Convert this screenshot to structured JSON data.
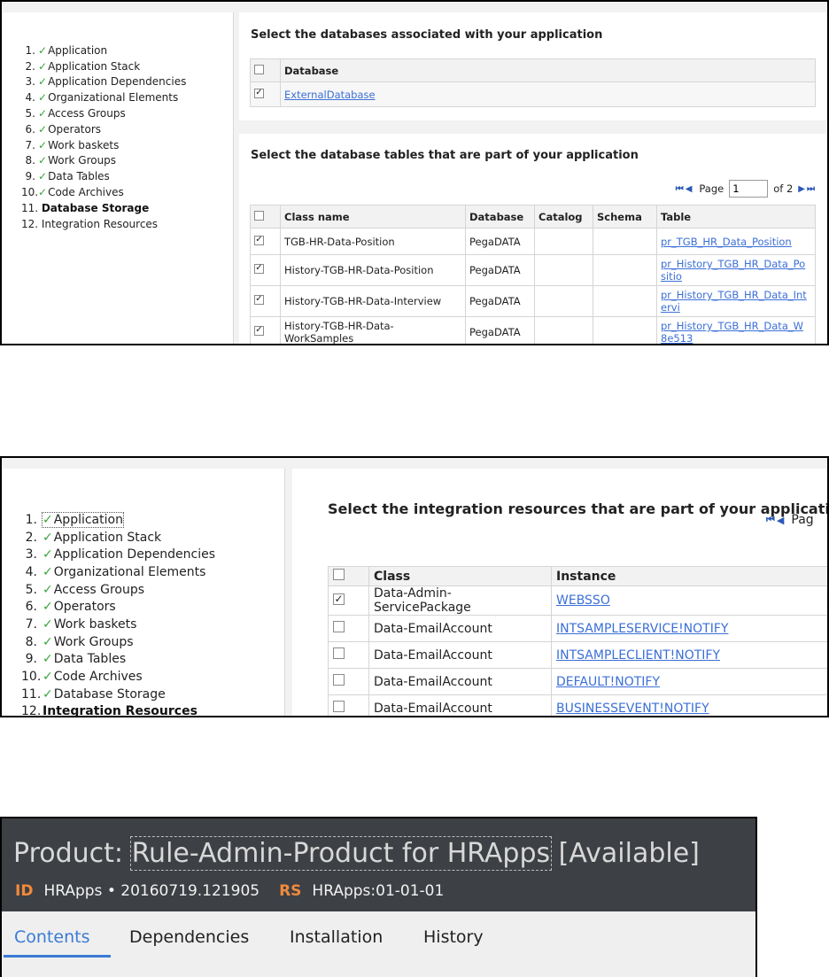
{
  "nav1": {
    "items": [
      {
        "num": "1.",
        "label": "Application",
        "done": true
      },
      {
        "num": "2.",
        "label": "Application Stack",
        "done": true
      },
      {
        "num": "3.",
        "label": "Application Dependencies",
        "done": true
      },
      {
        "num": "4.",
        "label": "Organizational Elements",
        "done": true
      },
      {
        "num": "5.",
        "label": "Access Groups",
        "done": true
      },
      {
        "num": "6.",
        "label": "Operators",
        "done": true
      },
      {
        "num": "7.",
        "label": "Work baskets",
        "done": true
      },
      {
        "num": "8.",
        "label": "Work Groups",
        "done": true
      },
      {
        "num": "9.",
        "label": "Data Tables",
        "done": true
      },
      {
        "num": "10.",
        "label": "Code Archives",
        "done": true
      },
      {
        "num": "11.",
        "label": "Database Storage",
        "done": false
      },
      {
        "num": "12.",
        "label": "Integration Resources",
        "done": false
      }
    ]
  },
  "databases": {
    "heading": "Select the databases associated with your application",
    "header": "Database",
    "rows": [
      {
        "checked": true,
        "name": "ExternalDatabase"
      }
    ]
  },
  "db_tables": {
    "heading": "Select the database tables that are part of your application",
    "pager": {
      "page_label": "Page",
      "page_value": "1",
      "of_label": "of 2"
    },
    "headers": {
      "class": "Class name",
      "database": "Database",
      "catalog": "Catalog",
      "schema": "Schema",
      "table": "Table"
    },
    "rows": [
      {
        "checked": true,
        "class": "TGB-HR-Data-Position",
        "database": "PegaDATA",
        "catalog": "",
        "schema": "",
        "table": "pr_TGB_HR_Data_Position"
      },
      {
        "checked": true,
        "class": "History-TGB-HR-Data-Position",
        "database": "PegaDATA",
        "catalog": "",
        "schema": "",
        "table": "pr_History_TGB_HR_Data_Po sitio"
      },
      {
        "checked": true,
        "class": "History-TGB-HR-Data-Interview",
        "database": "PegaDATA",
        "catalog": "",
        "schema": "",
        "table": "pr_History_TGB_HR_Data_Int ervi"
      },
      {
        "checked": true,
        "class": "History-TGB-HR-Data-WorkSamples",
        "database": "PegaDATA",
        "catalog": "",
        "schema": "",
        "table": "pr_History_TGB_HR_Data_W 8e513"
      }
    ]
  },
  "nav2": {
    "items": [
      {
        "num": "1.",
        "label": "Application",
        "done": true
      },
      {
        "num": "2.",
        "label": "Application Stack",
        "done": true
      },
      {
        "num": "3.",
        "label": "Application Dependencies",
        "done": true
      },
      {
        "num": "4.",
        "label": "Organizational Elements",
        "done": true
      },
      {
        "num": "5.",
        "label": "Access Groups",
        "done": true
      },
      {
        "num": "6.",
        "label": "Operators",
        "done": true
      },
      {
        "num": "7.",
        "label": "Work baskets",
        "done": true
      },
      {
        "num": "8.",
        "label": "Work Groups",
        "done": true
      },
      {
        "num": "9.",
        "label": "Data Tables",
        "done": true
      },
      {
        "num": "10.",
        "label": "Code Archives",
        "done": true
      },
      {
        "num": "11.",
        "label": "Database Storage",
        "done": true
      },
      {
        "num": "12.",
        "label": "Integration Resources",
        "done": false
      }
    ]
  },
  "integration": {
    "heading": "Select the integration resources that are part of your application",
    "pager_label": "Pag",
    "headers": {
      "class": "Class",
      "instance": "Instance"
    },
    "rows": [
      {
        "checked": true,
        "class": "Data-Admin-ServicePackage",
        "instance": "WEBSSO"
      },
      {
        "checked": false,
        "class": "Data-EmailAccount",
        "instance": "INTSAMPLESERVICE!NOTIFY"
      },
      {
        "checked": false,
        "class": "Data-EmailAccount",
        "instance": "INTSAMPLECLIENT!NOTIFY"
      },
      {
        "checked": false,
        "class": "Data-EmailAccount",
        "instance": "DEFAULT!NOTIFY"
      },
      {
        "checked": false,
        "class": "Data-EmailAccount",
        "instance": "BUSINESSEVENT!NOTIFY"
      }
    ]
  },
  "product": {
    "title_prefix": "Product:",
    "title_rule": "Rule-Admin-Product for HRApps",
    "title_status": "[Available]",
    "id_tag": "ID",
    "id_value": "HRApps • 20160719.121905",
    "rs_tag": "RS",
    "rs_value": "HRApps:01-01-01",
    "tabs": [
      "Contents",
      "Dependencies",
      "Installation",
      "History"
    ]
  },
  "colors": {
    "check": "#3aa53a",
    "link": "#3b6fd6",
    "accent": "#3a7bd5",
    "tag": "#f08a3c",
    "header_bg": "#3d4044"
  }
}
